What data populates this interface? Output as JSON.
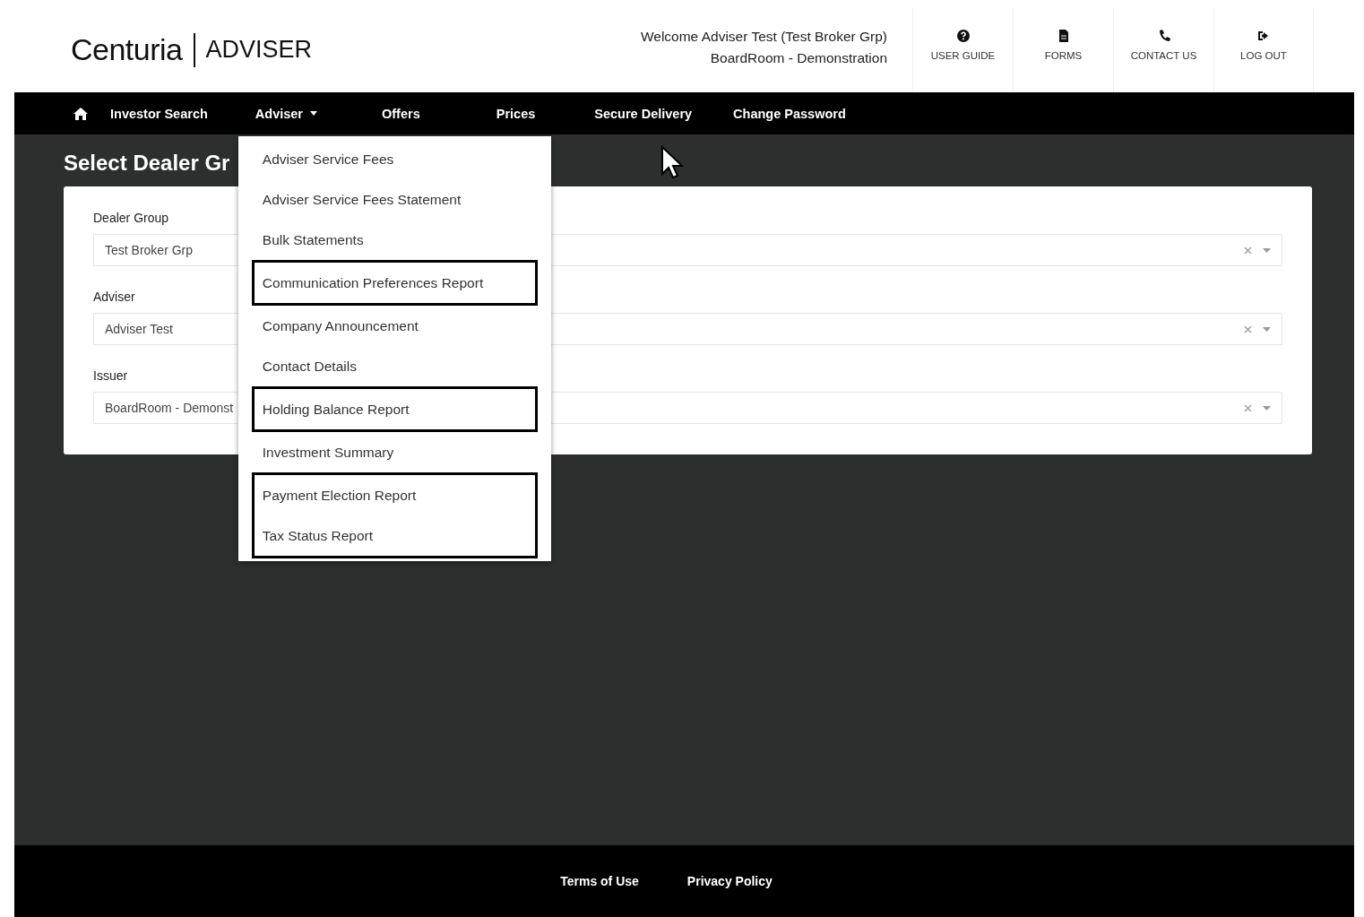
{
  "header": {
    "logo": {
      "brand": "Centuria",
      "product": "ADVISER"
    },
    "welcome": [
      "Welcome Adviser Test (Test Broker Grp)",
      "BoardRoom - Demonstration"
    ],
    "actions": [
      {
        "label": "USER GUIDE"
      },
      {
        "label": "FORMS"
      },
      {
        "label": "CONTACT US"
      },
      {
        "label": "LOG OUT"
      }
    ]
  },
  "nav": {
    "items": [
      {
        "kind": "link",
        "label": "Investor Search"
      },
      {
        "kind": "dropdown",
        "label": "Adviser",
        "expanded": true,
        "menu": [
          {
            "outlined": false,
            "items": [
              "Adviser Service Fees",
              "Adviser Service Fees Statement",
              "Bulk Statements"
            ]
          },
          {
            "outlined": true,
            "items": [
              "Communication Preferences Report"
            ]
          },
          {
            "outlined": false,
            "items": [
              "Company Announcement",
              "Contact Details"
            ]
          },
          {
            "outlined": true,
            "items": [
              "Holding Balance Report"
            ]
          },
          {
            "outlined": false,
            "items": [
              "Investment Summary"
            ]
          },
          {
            "outlined": true,
            "items": [
              "Payment Election Report",
              "Tax Status Report"
            ]
          }
        ]
      },
      {
        "kind": "link",
        "label": "Offers"
      },
      {
        "kind": "link",
        "label": "Prices"
      },
      {
        "kind": "link",
        "label": "Secure Delivery"
      },
      {
        "kind": "link",
        "label": "Change Password"
      }
    ]
  },
  "page_title": "Select Dealer Gr",
  "form": {
    "fields": [
      {
        "label": "Dealer Group",
        "value": "Test Broker Grp"
      },
      {
        "label": "Adviser",
        "value": "Adviser Test"
      },
      {
        "label": "Issuer",
        "value": "BoardRoom - Demonst"
      }
    ]
  },
  "footer": {
    "links": [
      "Terms of Use",
      "Privacy Policy"
    ]
  }
}
